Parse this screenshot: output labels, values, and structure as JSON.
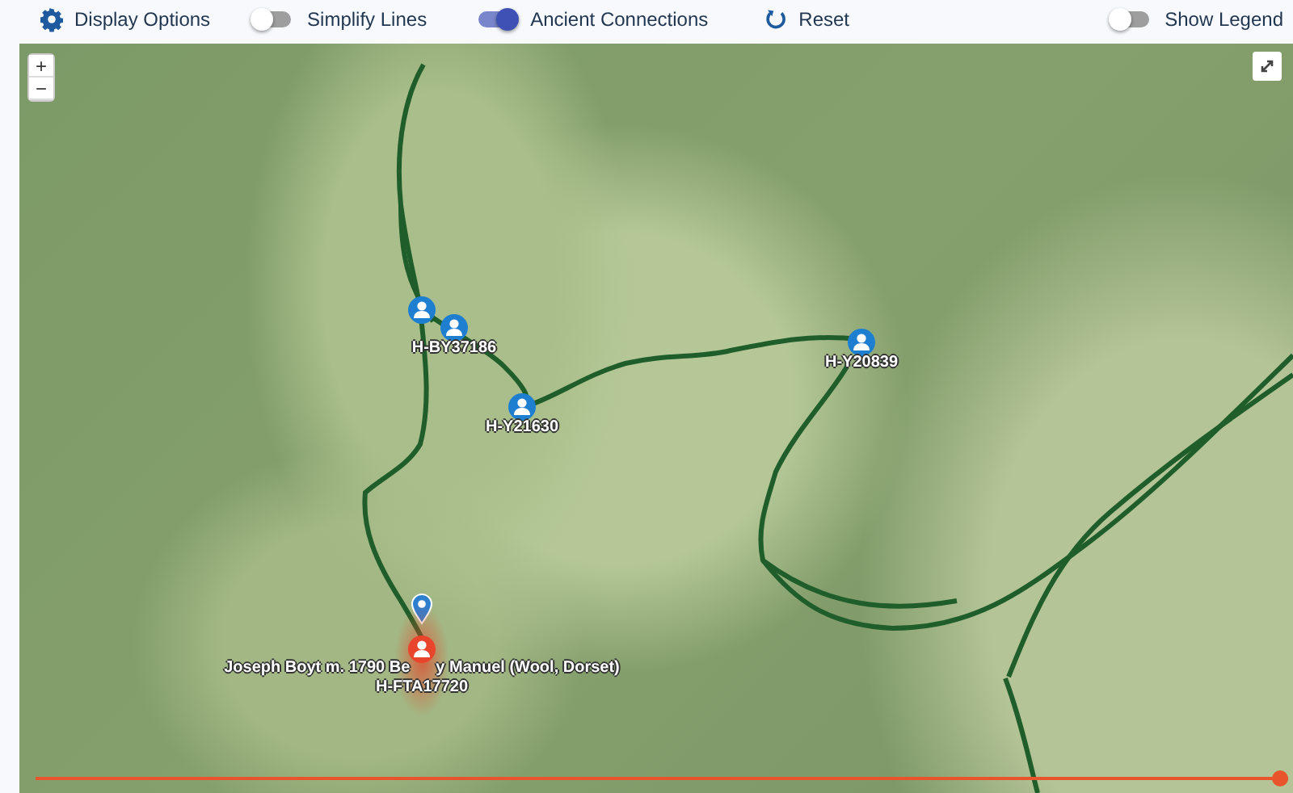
{
  "toolbar": {
    "display_options": "Display Options",
    "toggles": [
      {
        "label": "Simplify Lines",
        "on": false
      },
      {
        "label": "Ancient Connections",
        "on": true
      }
    ],
    "reset": "Reset",
    "legend_toggle": {
      "label": "Show Legend",
      "on": false
    }
  },
  "map": {
    "zoom_in": "+",
    "zoom_out": "−",
    "markers": [
      {
        "kind": "person"
      },
      {
        "kind": "person",
        "label": "H-BY37186"
      },
      {
        "kind": "person",
        "label": "H-Y21630"
      },
      {
        "kind": "person",
        "label": "H-Y20839"
      },
      {
        "kind": "pin"
      },
      {
        "kind": "highlighted",
        "label_parts": [
          "Joseph Boyt m. 1790 Be",
          "y Manuel (Wool, Dorset)"
        ],
        "label": "H-FTA17720"
      }
    ]
  },
  "timeline": {
    "level": 1
  }
}
